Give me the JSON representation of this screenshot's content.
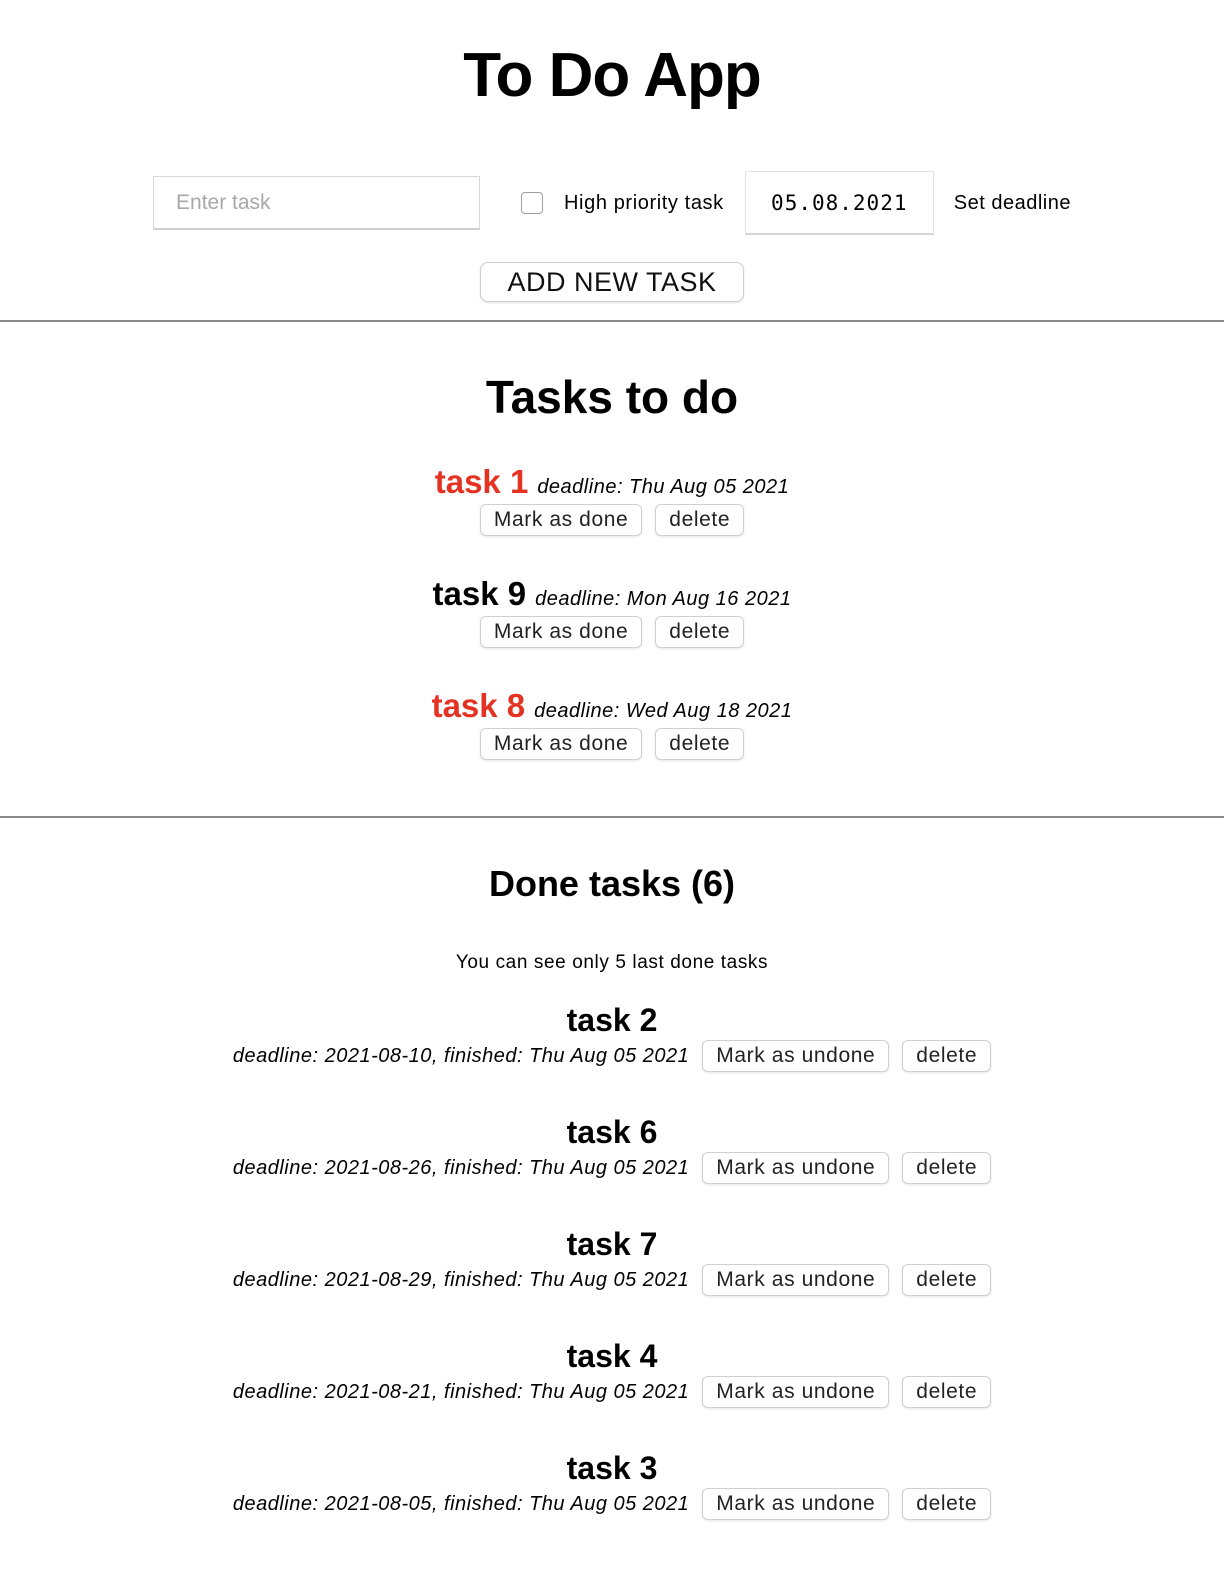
{
  "app": {
    "title": "To Do App"
  },
  "form": {
    "task_placeholder": "Enter task",
    "task_value": "",
    "priority_label": "High priority task",
    "priority_checked": false,
    "date_value": "05.08.2021",
    "date_label": "Set deadline",
    "add_button": "ADD NEW TASK"
  },
  "todo": {
    "title": "Tasks to do",
    "items": [
      {
        "name": "task 1",
        "deadline": "deadline: Thu Aug 05 2021",
        "high_priority": true,
        "done_button": "Mark as done",
        "delete_button": "delete"
      },
      {
        "name": "task 9",
        "deadline": "deadline: Mon Aug 16 2021",
        "high_priority": false,
        "done_button": "Mark as done",
        "delete_button": "delete"
      },
      {
        "name": "task 8",
        "deadline": "deadline: Wed Aug 18 2021",
        "high_priority": true,
        "done_button": "Mark as done",
        "delete_button": "delete"
      }
    ]
  },
  "done": {
    "title": "Done tasks (6)",
    "note": "You can see only 5 last done tasks",
    "items": [
      {
        "name": "task 2",
        "meta": "deadline: 2021-08-10, finished: Thu Aug 05 2021",
        "undone_button": "Mark as undone",
        "delete_button": "delete"
      },
      {
        "name": "task 6",
        "meta": "deadline: 2021-08-26, finished: Thu Aug 05 2021",
        "undone_button": "Mark as undone",
        "delete_button": "delete"
      },
      {
        "name": "task 7",
        "meta": "deadline: 2021-08-29, finished: Thu Aug 05 2021",
        "undone_button": "Mark as undone",
        "delete_button": "delete"
      },
      {
        "name": "task 4",
        "meta": "deadline: 2021-08-21, finished: Thu Aug 05 2021",
        "undone_button": "Mark as undone",
        "delete_button": "delete"
      },
      {
        "name": "task 3",
        "meta": "deadline: 2021-08-05, finished: Thu Aug 05 2021",
        "undone_button": "Mark as undone",
        "delete_button": "delete"
      }
    ]
  },
  "colors": {
    "high_priority": "#e53323",
    "text": "#000000",
    "divider": "#8a8a8a"
  }
}
